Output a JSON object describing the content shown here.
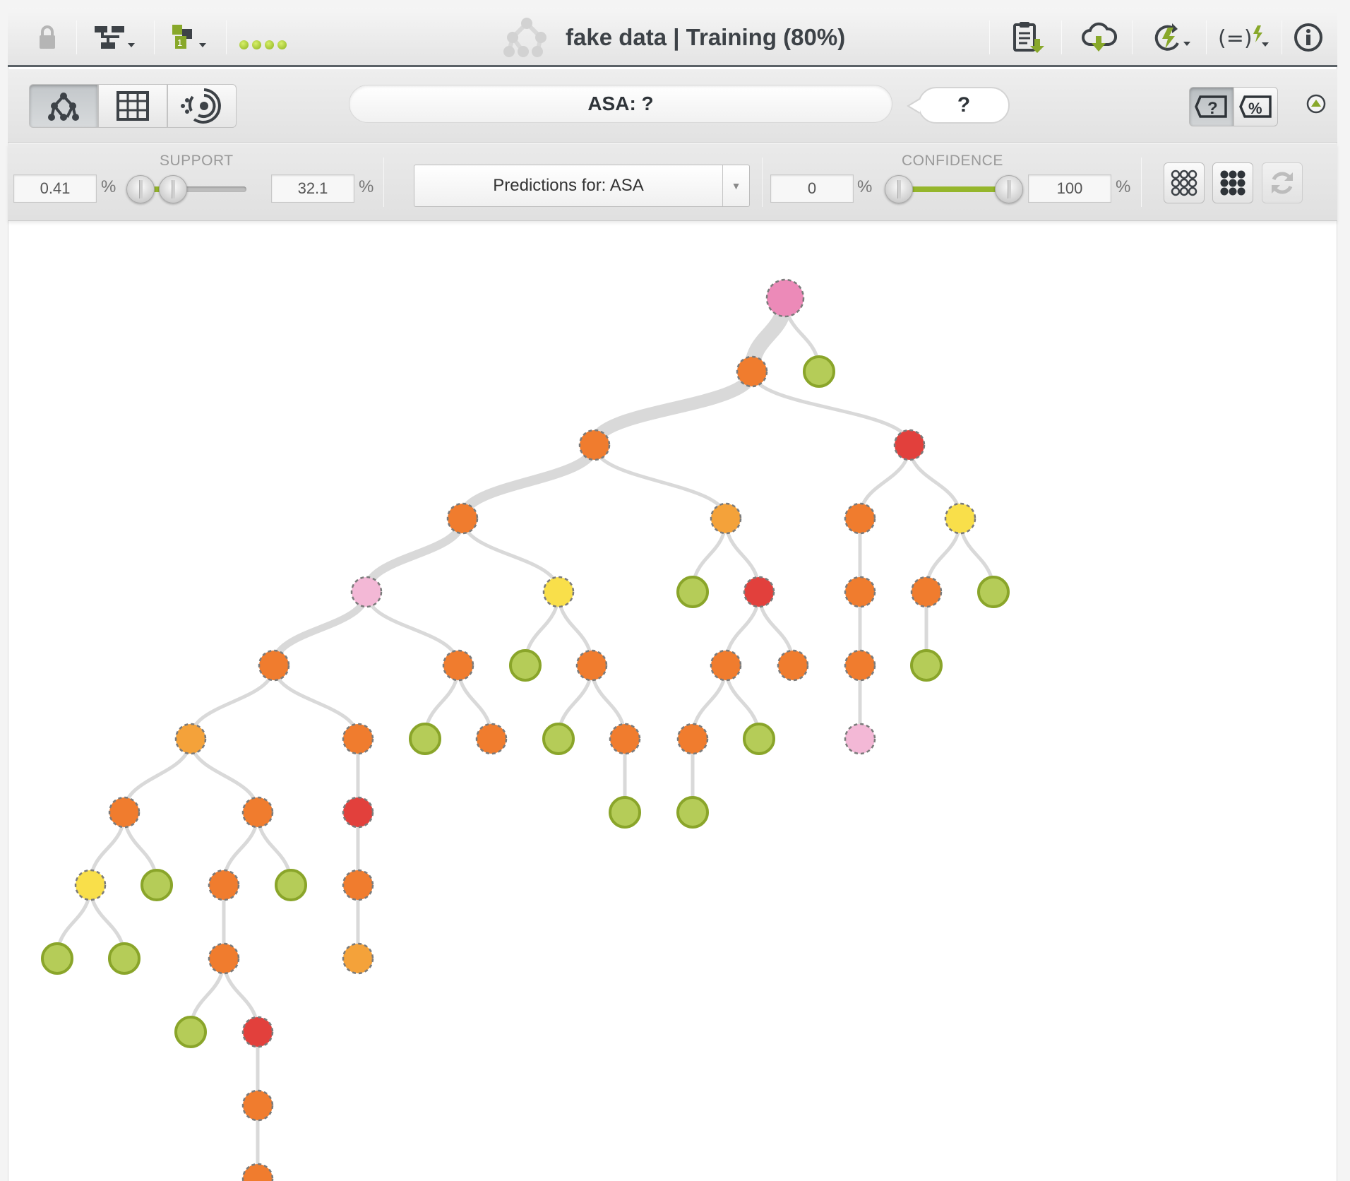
{
  "header": {
    "title": "fake data | Training (80%)",
    "icons": [
      "lock-icon",
      "tree-options-icon",
      "model-summary-icon",
      "status-dots",
      "model-logo-icon",
      "report-icon",
      "download-icon",
      "predict-icon",
      "actionable-model-icon",
      "info-icon"
    ]
  },
  "views": {
    "items": [
      "tree-view",
      "grid-view",
      "sunburst-view"
    ],
    "active": "tree-view"
  },
  "path": {
    "text": "ASA: ?"
  },
  "prediction": {
    "text": "?"
  },
  "toggles": {
    "items": [
      "prediction-toggle",
      "confidence-toggle"
    ],
    "active": "prediction-toggle"
  },
  "filters": {
    "support": {
      "label": "SUPPORT",
      "min": "0.41",
      "max": "32.1",
      "unit": "%",
      "range_percent": [
        0.41,
        32.1
      ]
    },
    "select": {
      "value": "Predictions for: ASA"
    },
    "confidence": {
      "label": "CONFIDENCE",
      "min": "0",
      "max": "100",
      "unit": "%",
      "range_percent": [
        0,
        100
      ]
    },
    "buttons": [
      "show-all-nodes-icon",
      "show-filtered-nodes-icon",
      "reset-filters-icon"
    ]
  },
  "colors": {
    "green": "#b5cc58",
    "green_stroke": "#8aa52a",
    "orange": "#f07c2e",
    "light_orange": "#f4a23a",
    "red": "#e2403c",
    "yellow": "#f9df4a",
    "pink": "#ec8ab8",
    "light_pink": "#f3b8d6",
    "node_stroke": "#7b7b7b",
    "branch": "#d9d9d9"
  },
  "tree": {
    "nodes": [
      {
        "id": "n0",
        "color": "pink"
      },
      {
        "id": "n1",
        "parent": "n0",
        "color": "orange"
      },
      {
        "id": "n2",
        "parent": "n0",
        "color": "green"
      },
      {
        "id": "n3",
        "parent": "n1",
        "color": "orange"
      },
      {
        "id": "n4",
        "parent": "n1",
        "color": "red"
      },
      {
        "id": "n5",
        "parent": "n3",
        "color": "orange"
      },
      {
        "id": "n6",
        "parent": "n3",
        "color": "light_orange"
      },
      {
        "id": "n7",
        "parent": "n4",
        "color": "orange"
      },
      {
        "id": "n8",
        "parent": "n4",
        "color": "yellow"
      },
      {
        "id": "n9",
        "parent": "n5",
        "color": "light_pink"
      },
      {
        "id": "n10",
        "parent": "n5",
        "color": "yellow"
      },
      {
        "id": "n11",
        "parent": "n6",
        "color": "green"
      },
      {
        "id": "n12",
        "parent": "n6",
        "color": "red"
      },
      {
        "id": "n13",
        "parent": "n7",
        "color": "orange"
      },
      {
        "id": "n14",
        "parent": "n8",
        "color": "orange"
      },
      {
        "id": "n15",
        "parent": "n8",
        "color": "green"
      },
      {
        "id": "n16",
        "parent": "n9",
        "color": "orange"
      },
      {
        "id": "n17",
        "parent": "n9",
        "color": "orange"
      },
      {
        "id": "n18",
        "parent": "n10",
        "color": "green"
      },
      {
        "id": "n19",
        "parent": "n10",
        "color": "orange"
      },
      {
        "id": "n20",
        "parent": "n12",
        "color": "orange"
      },
      {
        "id": "n21",
        "parent": "n12",
        "color": "orange"
      },
      {
        "id": "n22",
        "parent": "n13",
        "color": "orange"
      },
      {
        "id": "n23",
        "parent": "n14",
        "color": "green"
      },
      {
        "id": "n24",
        "parent": "n16",
        "color": "light_orange"
      },
      {
        "id": "n25",
        "parent": "n16",
        "color": "orange"
      },
      {
        "id": "n26",
        "parent": "n17",
        "color": "green"
      },
      {
        "id": "n27",
        "parent": "n17",
        "color": "orange"
      },
      {
        "id": "n28",
        "parent": "n19",
        "color": "green"
      },
      {
        "id": "n29",
        "parent": "n19",
        "color": "orange"
      },
      {
        "id": "n30",
        "parent": "n20",
        "color": "orange"
      },
      {
        "id": "n31",
        "parent": "n20",
        "color": "green"
      },
      {
        "id": "n32",
        "parent": "n22",
        "color": "light_pink"
      },
      {
        "id": "n33",
        "parent": "n24",
        "color": "orange"
      },
      {
        "id": "n34",
        "parent": "n24",
        "color": "orange"
      },
      {
        "id": "n35",
        "parent": "n25",
        "color": "red"
      },
      {
        "id": "n36",
        "parent": "n29",
        "color": "green"
      },
      {
        "id": "n37",
        "parent": "n30",
        "color": "green"
      },
      {
        "id": "n38",
        "parent": "n33",
        "color": "yellow"
      },
      {
        "id": "n39",
        "parent": "n33",
        "color": "green"
      },
      {
        "id": "n40",
        "parent": "n34",
        "color": "orange"
      },
      {
        "id": "n41",
        "parent": "n34",
        "color": "green"
      },
      {
        "id": "n42",
        "parent": "n35",
        "color": "orange"
      },
      {
        "id": "n43",
        "parent": "n38",
        "color": "green"
      },
      {
        "id": "n44",
        "parent": "n38",
        "color": "green"
      },
      {
        "id": "n45",
        "parent": "n40",
        "color": "orange"
      },
      {
        "id": "n46",
        "parent": "n42",
        "color": "light_orange"
      },
      {
        "id": "n47",
        "parent": "n45",
        "color": "green"
      },
      {
        "id": "n48",
        "parent": "n45",
        "color": "red"
      },
      {
        "id": "n49",
        "parent": "n48",
        "color": "orange"
      },
      {
        "id": "n50",
        "parent": "n49",
        "color": "orange"
      }
    ]
  }
}
